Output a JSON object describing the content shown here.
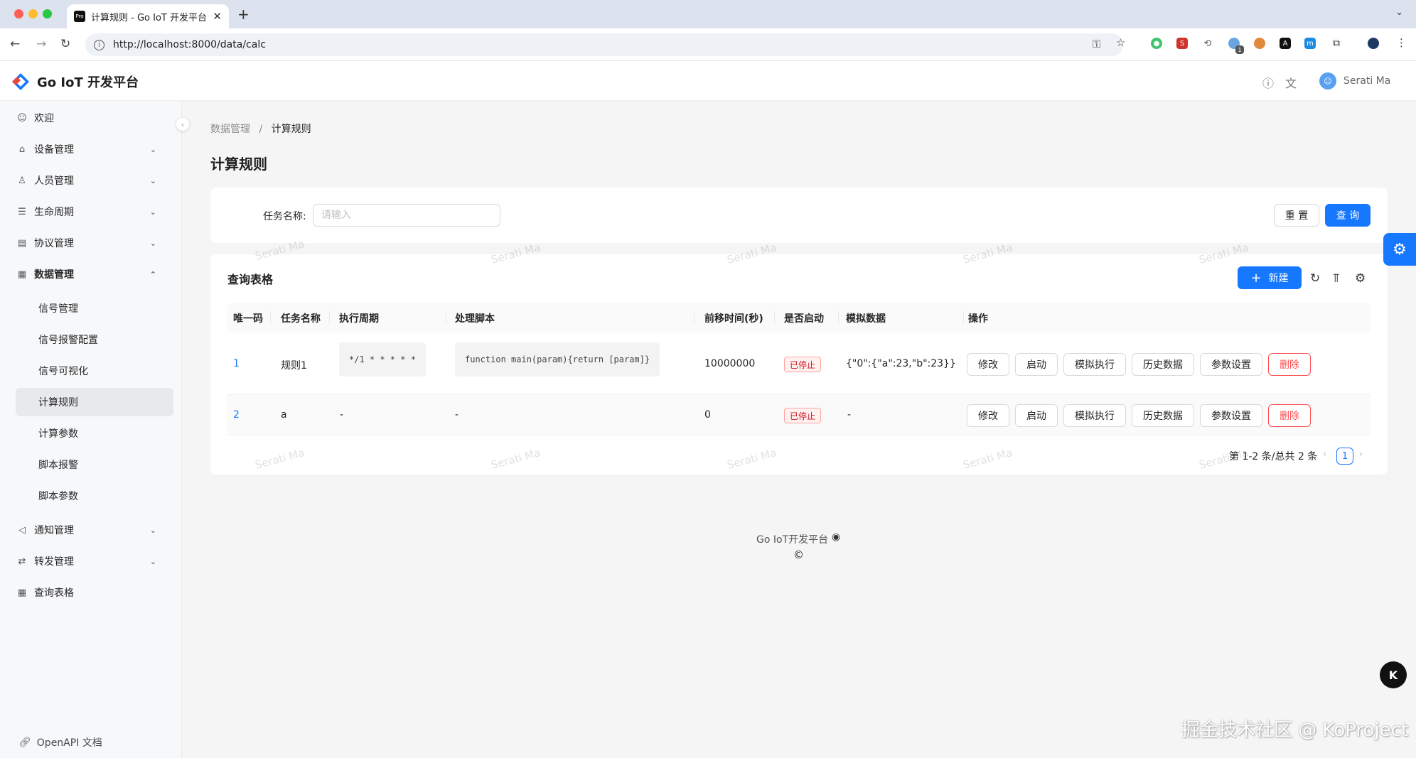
{
  "browser": {
    "tab_title": "计算规则 - Go IoT 开发平台",
    "favicon": "Pro",
    "url": "http://localhost:8000/data/calc",
    "extension_badge": "1"
  },
  "header": {
    "app_title": "Go IoT 开发平台",
    "user_name": "Serati Ma"
  },
  "sidebar": {
    "items": [
      {
        "label": "欢迎",
        "icon": "smile-icon"
      },
      {
        "label": "设备管理",
        "icon": "device-icon"
      },
      {
        "label": "人员管理",
        "icon": "users-icon"
      },
      {
        "label": "生命周期",
        "icon": "list-icon"
      },
      {
        "label": "协议管理",
        "icon": "protocol-icon"
      },
      {
        "label": "数据管理",
        "icon": "table-icon"
      }
    ],
    "sub_items": [
      {
        "label": "信号管理"
      },
      {
        "label": "信号报警配置"
      },
      {
        "label": "信号可视化"
      },
      {
        "label": "计算规则"
      },
      {
        "label": "计算参数"
      },
      {
        "label": "脚本报警"
      },
      {
        "label": "脚本参数"
      }
    ],
    "bottom_items": [
      {
        "label": "通知管理",
        "icon": "notify-icon"
      },
      {
        "label": "转发管理",
        "icon": "forward-icon"
      },
      {
        "label": "查询表格",
        "icon": "table-icon"
      }
    ],
    "openapi_label": "OpenAPI 文档"
  },
  "breadcrumb": {
    "parent": "数据管理",
    "separator": "/",
    "current": "计算规则"
  },
  "page_title": "计算规则",
  "search": {
    "label": "任务名称:",
    "placeholder": "请输入",
    "reset_label": "重 置",
    "query_label": "查 询"
  },
  "table": {
    "title": "查询表格",
    "new_label": "新建",
    "columns": [
      "唯一码",
      "任务名称",
      "执行周期",
      "处理脚本",
      "前移时间(秒)",
      "是否启动",
      "模拟数据",
      "操作"
    ],
    "rows": [
      {
        "id": "1",
        "name": "规则1",
        "cron": "*/1 * * * * *",
        "script": "function main(param){return [param]}",
        "offset": "10000000",
        "status": "已停止",
        "mock": "{\"0\":{\"a\":23,\"b\":23}}"
      },
      {
        "id": "2",
        "name": "a",
        "cron": "-",
        "script": "-",
        "offset": "0",
        "status": "已停止",
        "mock": "-"
      }
    ],
    "actions": [
      "修改",
      "启动",
      "模拟执行",
      "历史数据",
      "参数设置",
      "删除"
    ]
  },
  "pagination": {
    "summary": "第 1-2 条/总共 2 条",
    "current_page": "1"
  },
  "footer": {
    "text": "Go IoT开发平台",
    "copyright": "©"
  },
  "watermark_text": "Serati Ma",
  "site_watermark": "掘金技术社区 @ KoProject",
  "floating_button": "K",
  "colors": {
    "primary": "#1677ff",
    "danger": "#ff4d4f",
    "tag_red": "#cf1322"
  }
}
